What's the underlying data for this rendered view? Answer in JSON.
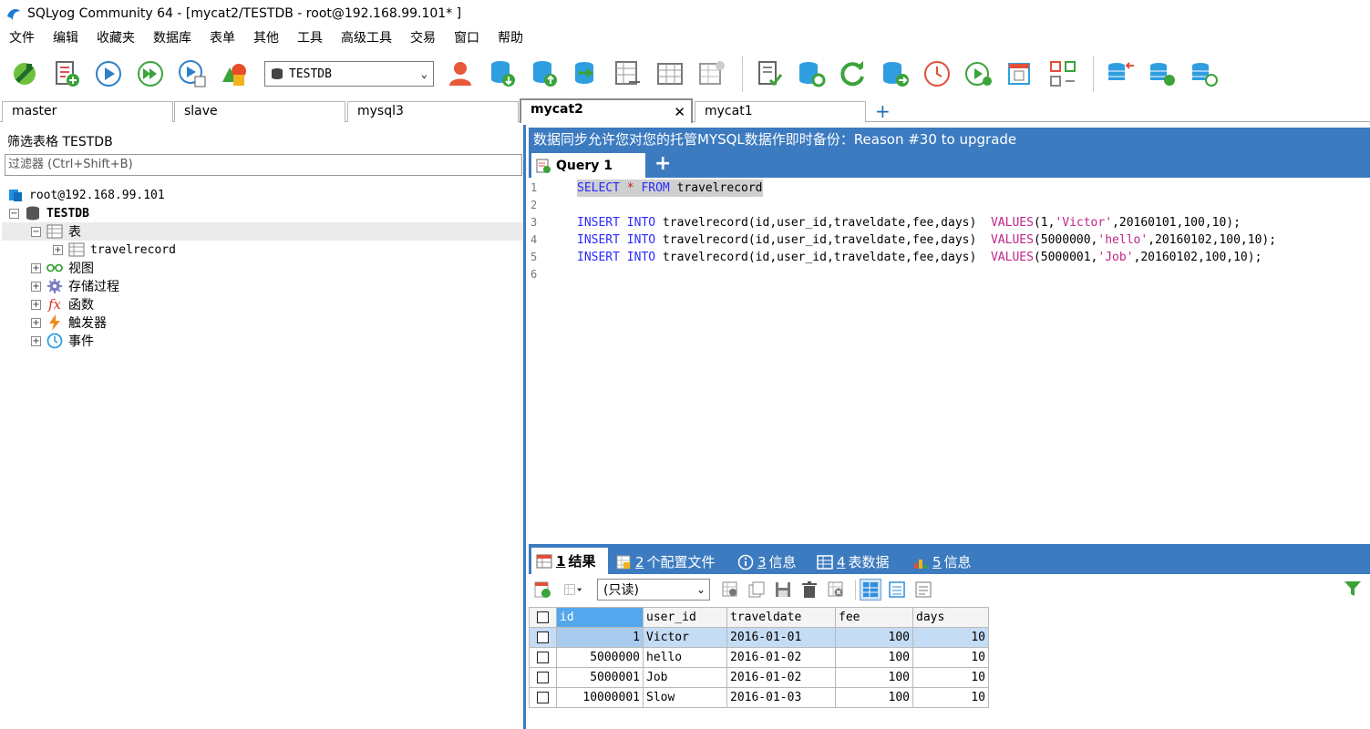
{
  "window": {
    "title": "SQLyog Community 64 - [mycat2/TESTDB - root@192.168.99.101* ]"
  },
  "menu": [
    "文件",
    "编辑",
    "收藏夹",
    "数据库",
    "表单",
    "其他",
    "工具",
    "高级工具",
    "交易",
    "窗口",
    "帮助"
  ],
  "toolbar": {
    "database_select": "TESTDB"
  },
  "connection_tabs": [
    {
      "label": "master"
    },
    {
      "label": "slave"
    },
    {
      "label": "mysql3"
    },
    {
      "label": "mycat2",
      "active": true
    },
    {
      "label": "mycat1"
    }
  ],
  "object_browser": {
    "filter_label": "筛选表格 TESTDB",
    "filter_placeholder": "过滤器 (Ctrl+Shift+B)",
    "connection": "root@192.168.99.101",
    "database": "TESTDB",
    "tables_node": "表",
    "table": "travelrecord",
    "views_node": "视图",
    "procs_node": "存储过程",
    "funcs_node": "函数",
    "triggers_node": "触发器",
    "events_node": "事件"
  },
  "banner": "数据同步允许您对您的托管MYSQL数据作即时备份：Reason #30 to upgrade",
  "query_tab": "Query 1",
  "editor": {
    "line_numbers": [
      "1",
      "2",
      "3",
      "4",
      "5",
      "6"
    ],
    "lines": [
      {
        "parts": [
          [
            "SELECT",
            "kw"
          ],
          [
            " ",
            ""
          ],
          [
            "*",
            "star"
          ],
          [
            " ",
            ""
          ],
          [
            "FROM",
            "kw"
          ],
          [
            " travelrecord",
            ""
          ]
        ]
      },
      {
        "parts": []
      },
      {
        "parts": [
          [
            "INSERT",
            "kw"
          ],
          [
            " ",
            ""
          ],
          [
            "INTO",
            "kw"
          ],
          [
            " travelrecord(id,user_id,traveldate,fee,days)  ",
            ""
          ],
          [
            "VALUES",
            "str"
          ],
          [
            "(1,",
            ""
          ],
          [
            "'Victor'",
            "str"
          ],
          [
            ",20160101,100,10);",
            ""
          ]
        ]
      },
      {
        "parts": [
          [
            "INSERT",
            "kw"
          ],
          [
            " ",
            ""
          ],
          [
            "INTO",
            "kw"
          ],
          [
            " travelrecord(id,user_id,traveldate,fee,days)  ",
            ""
          ],
          [
            "VALUES",
            "str"
          ],
          [
            "(5000000,",
            ""
          ],
          [
            "'hello'",
            "str"
          ],
          [
            ",20160102,100,10);",
            ""
          ]
        ]
      },
      {
        "parts": [
          [
            "INSERT",
            "kw"
          ],
          [
            " ",
            ""
          ],
          [
            "INTO",
            "kw"
          ],
          [
            " travelrecord(id,user_id,traveldate,fee,days)  ",
            ""
          ],
          [
            "VALUES",
            "str"
          ],
          [
            "(5000001,",
            ""
          ],
          [
            "'Job'",
            "str"
          ],
          [
            ",20160102,100,10);",
            ""
          ]
        ]
      },
      {
        "parts": []
      }
    ]
  },
  "result_tabs": [
    {
      "num": "1",
      "label": "结果"
    },
    {
      "num": "2",
      "label": "个配置文件"
    },
    {
      "num": "3",
      "label": "信息"
    },
    {
      "num": "4",
      "label": "表数据"
    },
    {
      "num": "5",
      "label": "信息"
    }
  ],
  "result_toolbar": {
    "mode_select": "(只读)"
  },
  "result_grid": {
    "columns": [
      "id",
      "user_id",
      "traveldate",
      "fee",
      "days"
    ],
    "rows": [
      [
        "1",
        "Victor",
        "2016-01-01",
        "100",
        "10"
      ],
      [
        "5000000",
        "hello",
        "2016-01-02",
        "100",
        "10"
      ],
      [
        "5000001",
        "Job",
        "2016-01-02",
        "100",
        "10"
      ],
      [
        "10000001",
        "Slow",
        "2016-01-03",
        "100",
        "10"
      ]
    ]
  },
  "colors": {
    "accent": "#3c7bc0",
    "header_sorted": "#54a7ec",
    "selected_row": "#c5dcf5",
    "keyword": "#2a2aff",
    "string": "#c0268a"
  }
}
